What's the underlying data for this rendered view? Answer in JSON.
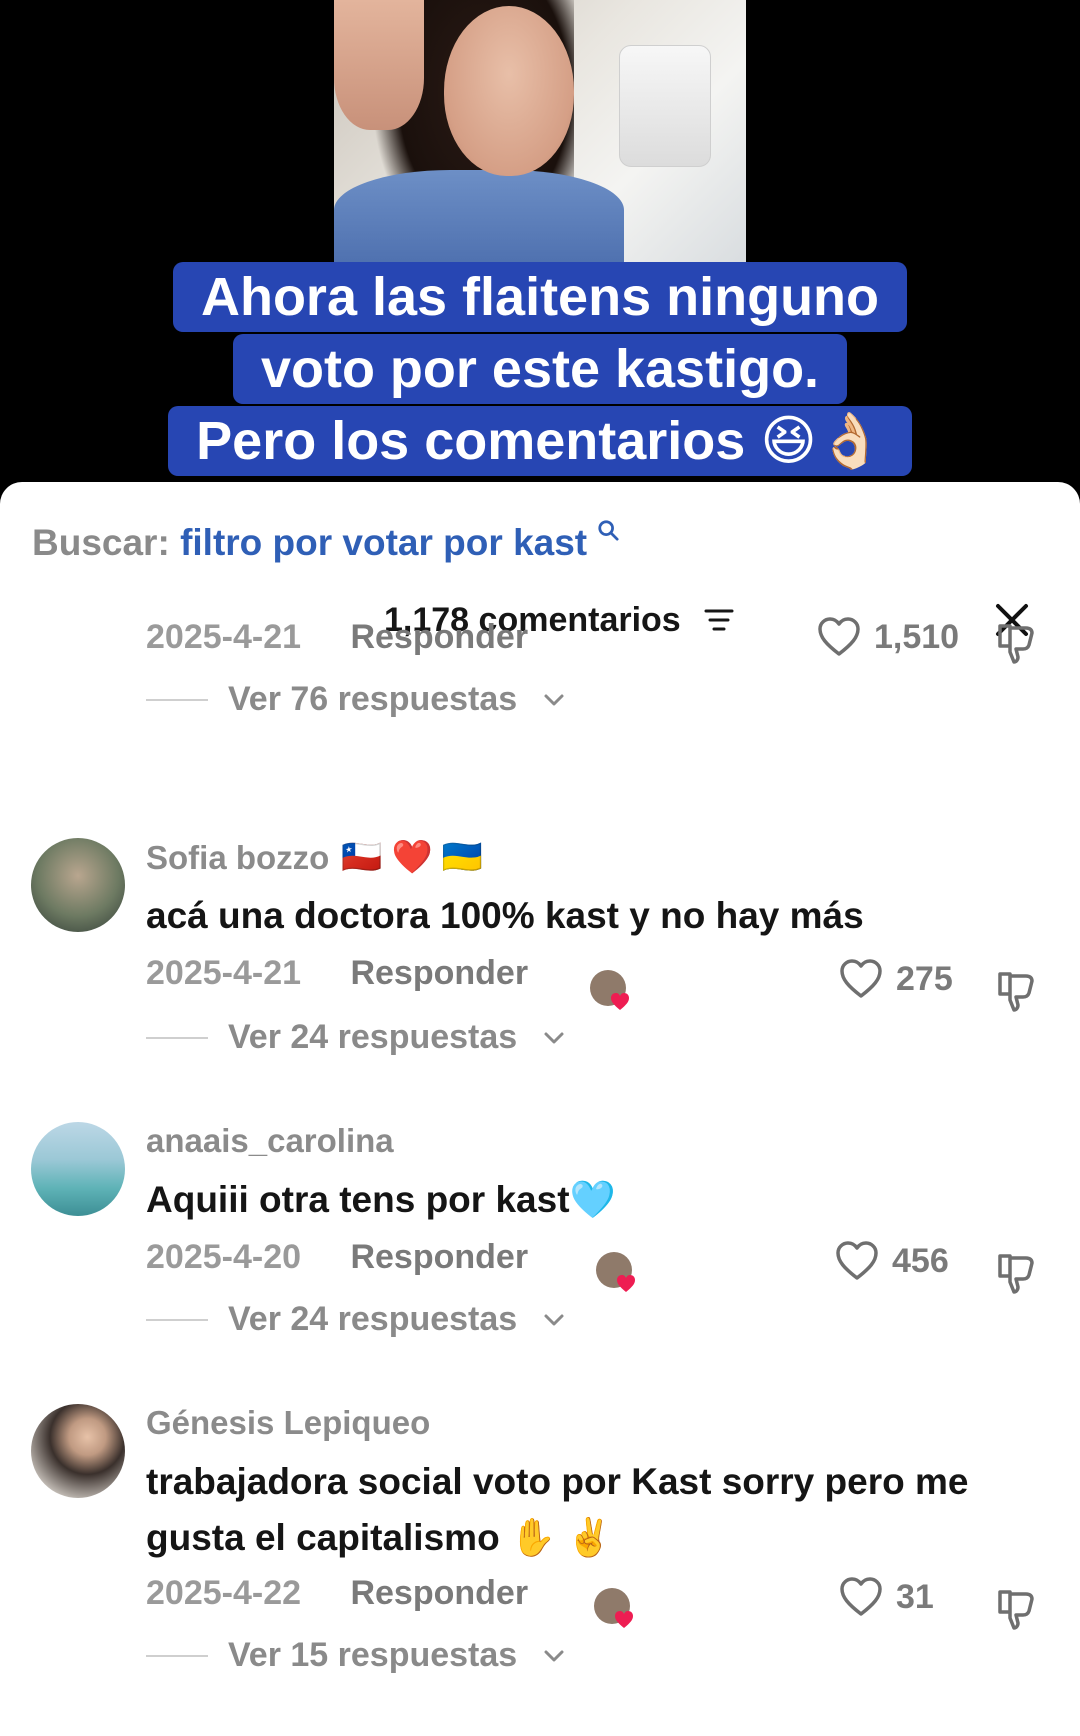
{
  "caption": {
    "line1": "Ahora las flaitens ninguno",
    "line2": "voto por este kastigo.",
    "line3": "Pero los comentarios 😆👌🏻"
  },
  "search": {
    "label": "Buscar:",
    "query": "filtro por votar por kast"
  },
  "header": {
    "count": "1,178 comentarios"
  },
  "top_partial": {
    "date": "2025-4-21",
    "reply_label": "Responder",
    "likes": "1,510",
    "replies_label": "Ver 76 respuestas"
  },
  "comments": [
    {
      "username": "Sofia bozzo",
      "user_emoji": "🇨🇱 ❤️ 🇺🇦",
      "text": "acá una doctora 100% kast y no hay más",
      "date": "2025-4-21",
      "reply_label": "Responder",
      "likes": "275",
      "replies_label": "Ver 24 respuestas"
    },
    {
      "username": "anaais_carolina",
      "text": "Aquiii otra tens por kast🩵",
      "date": "2025-4-20",
      "reply_label": "Responder",
      "likes": "456",
      "replies_label": "Ver 24 respuestas"
    },
    {
      "username": "Génesis Lepiqueo",
      "text": "trabajadora social voto por Kast sorry pero me gusta el capitalismo ✋ ✌️",
      "date": "2025-4-22",
      "reply_label": "Responder",
      "likes": "31",
      "replies_label": "Ver 15 respuestas"
    }
  ],
  "colors": {
    "caption_bg": "#2746b3",
    "search_query": "#2f5fb6",
    "heart": "#ee1d52"
  }
}
